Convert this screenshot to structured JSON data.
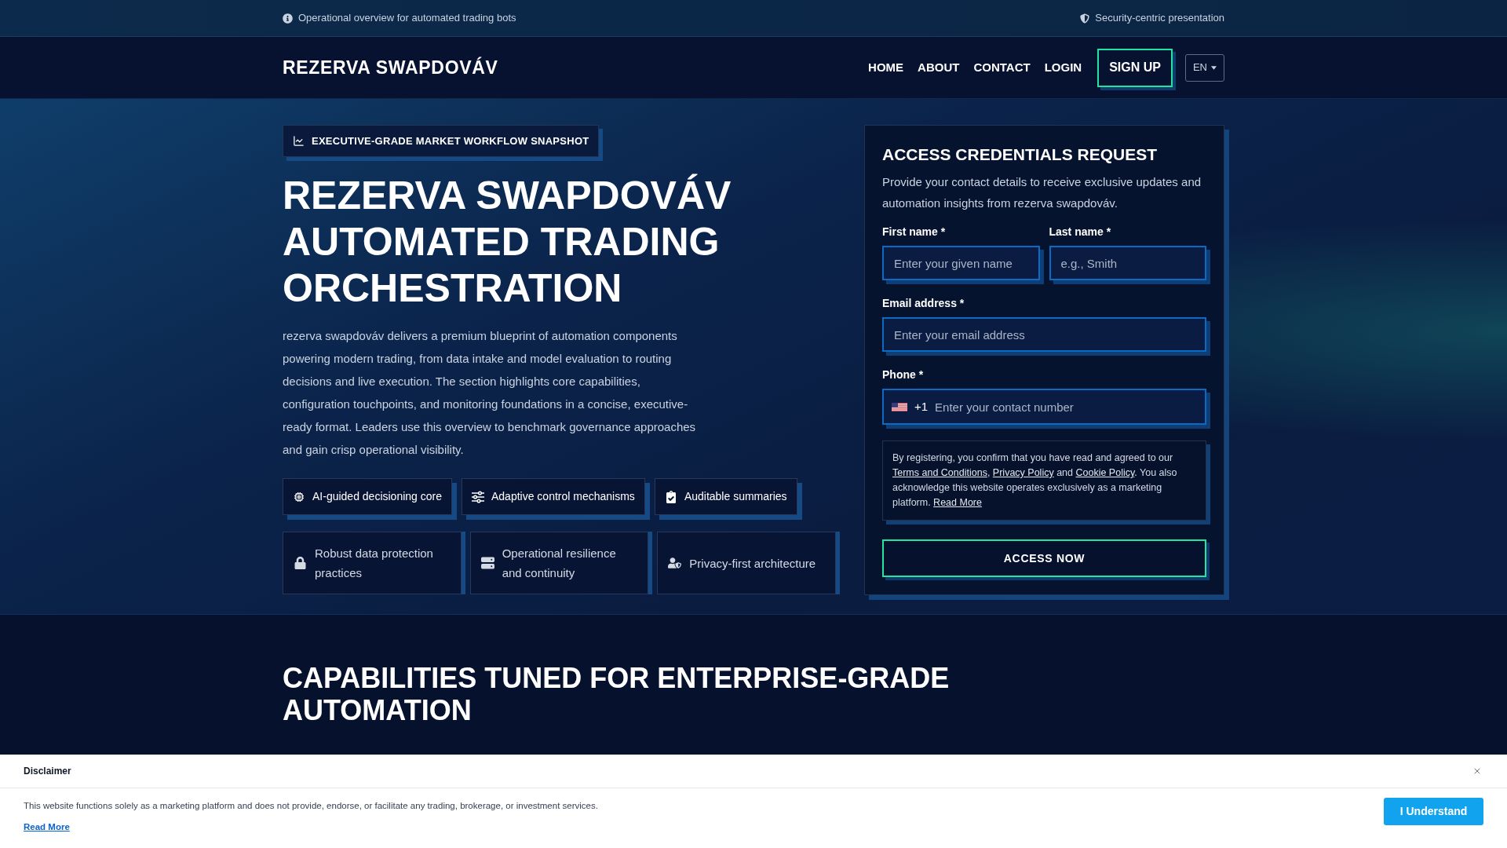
{
  "top_bar": {
    "left_text": "Operational overview for automated trading bots",
    "right_text": "Security-centric presentation"
  },
  "nav": {
    "logo": "REZERVA SWAPDOVÁV",
    "links": [
      {
        "label": "HOME"
      },
      {
        "label": "ABOUT"
      },
      {
        "label": "CONTACT"
      },
      {
        "label": "LOGIN"
      }
    ],
    "cta": "SIGN UP",
    "language": "EN"
  },
  "hero": {
    "badge": "EXECUTIVE-GRADE MARKET WORKFLOW SNAPSHOT",
    "title": "REZERVA SWAPDOVÁV AUTOMATED TRADING ORCHESTRATION",
    "description": "rezerva swapdováv delivers a premium blueprint of automation components powering modern trading, from data intake and model evaluation to routing decisions and live execution. The section highlights core capabilities, configuration touchpoints, and monitoring foundations in a concise, executive-ready format. Leaders use this overview to benchmark governance approaches and gain crisp operational visibility.",
    "chips": [
      {
        "label": "AI-guided decisioning core"
      },
      {
        "label": "Adaptive control mechanisms"
      },
      {
        "label": "Auditable summaries"
      }
    ],
    "cards": [
      {
        "label": "Robust data protection practices"
      },
      {
        "label": "Operational resilience and continuity"
      },
      {
        "label": "Privacy-first architecture"
      }
    ]
  },
  "form": {
    "title": "ACCESS CREDENTIALS REQUEST",
    "description": "Provide your contact details to receive exclusive updates and automation insights from rezerva swapdováv.",
    "fields": [
      {
        "kind": "text",
        "label": "First name *",
        "placeholder": "Enter your given name"
      },
      {
        "kind": "text",
        "label": "Last name *",
        "placeholder": "e.g., Smith"
      },
      {
        "kind": "email",
        "label": "Email address *",
        "placeholder": "Enter your email address"
      },
      {
        "kind": "phone",
        "label": "Phone *",
        "country_code": "+1",
        "placeholder": "Enter your contact number"
      }
    ],
    "consent": [
      {
        "kind": "text",
        "text": "By registering, you confirm that you have read and agreed to our "
      },
      {
        "kind": "link",
        "text": "Terms and Conditions"
      },
      {
        "kind": "text",
        "text": ", "
      },
      {
        "kind": "link",
        "text": "Privacy Policy"
      },
      {
        "kind": "text",
        "text": " and "
      },
      {
        "kind": "link",
        "text": "Cookie Policy"
      },
      {
        "kind": "text",
        "text": ". You also acknowledge this website operates exclusively as a marketing platform. "
      },
      {
        "kind": "link",
        "text": "Read More"
      }
    ],
    "submit": "ACCESS NOW"
  },
  "capabilities": {
    "title": "CAPABILITIES TUNED FOR ENTERPRISE-GRADE AUTOMATION"
  },
  "disclaimer": {
    "title": "Disclaimer",
    "text": "This website functions solely as a marketing platform and does not provide, endorse, or facilitate any trading, brokerage, or investment services.",
    "link": "Read More",
    "button": "I Understand"
  }
}
